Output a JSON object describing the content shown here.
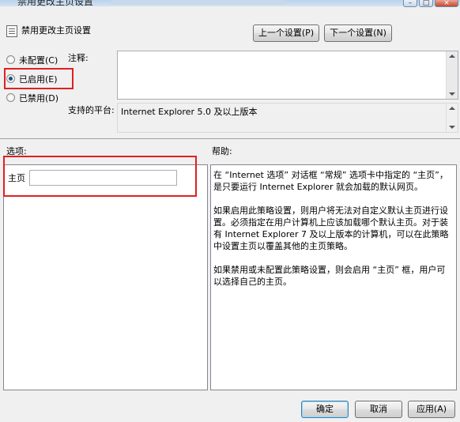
{
  "window": {
    "title": "禁用更改主页设置",
    "controls": {
      "minimize": "–",
      "maximize": "□",
      "close": "×"
    }
  },
  "header": {
    "policy_title": "禁用更改主页设置",
    "prev_button": "上一个设置(P)",
    "next_button": "下一个设置(N)"
  },
  "state": {
    "options": [
      {
        "label": "未配置(C)",
        "checked": false
      },
      {
        "label": "已启用(E)",
        "checked": true
      },
      {
        "label": "已禁用(D)",
        "checked": false
      }
    ]
  },
  "comment": {
    "label": "注释:",
    "value": ""
  },
  "platform": {
    "label": "支持的平台:",
    "value": "Internet Explorer 5.0 及以上版本"
  },
  "options_section": {
    "label": "选项:",
    "homepage_label": "主页",
    "homepage_value": ""
  },
  "help": {
    "label": "帮助:",
    "paragraphs": [
      "在 “Internet 选项” 对话框 “常规” 选项卡中指定的 “主页”，是只要运行 Internet Explorer 就会加载的默认网页。",
      "如果启用此策略设置，则用户将无法对自定义默认主页进行设置。必须指定在用户计算机上应该加载哪个默认主页。对于装有 Internet Explorer 7 及以上版本的计算机，可以在此策略中设置主页以覆盖其他的主页策略。",
      "如果禁用或未配置此策略设置，则会启用 “主页” 框，用户可以选择自己的主页。"
    ]
  },
  "footer": {
    "ok": "确定",
    "cancel": "取消",
    "apply": "应用(A)"
  },
  "annotation_color": "#e02020"
}
